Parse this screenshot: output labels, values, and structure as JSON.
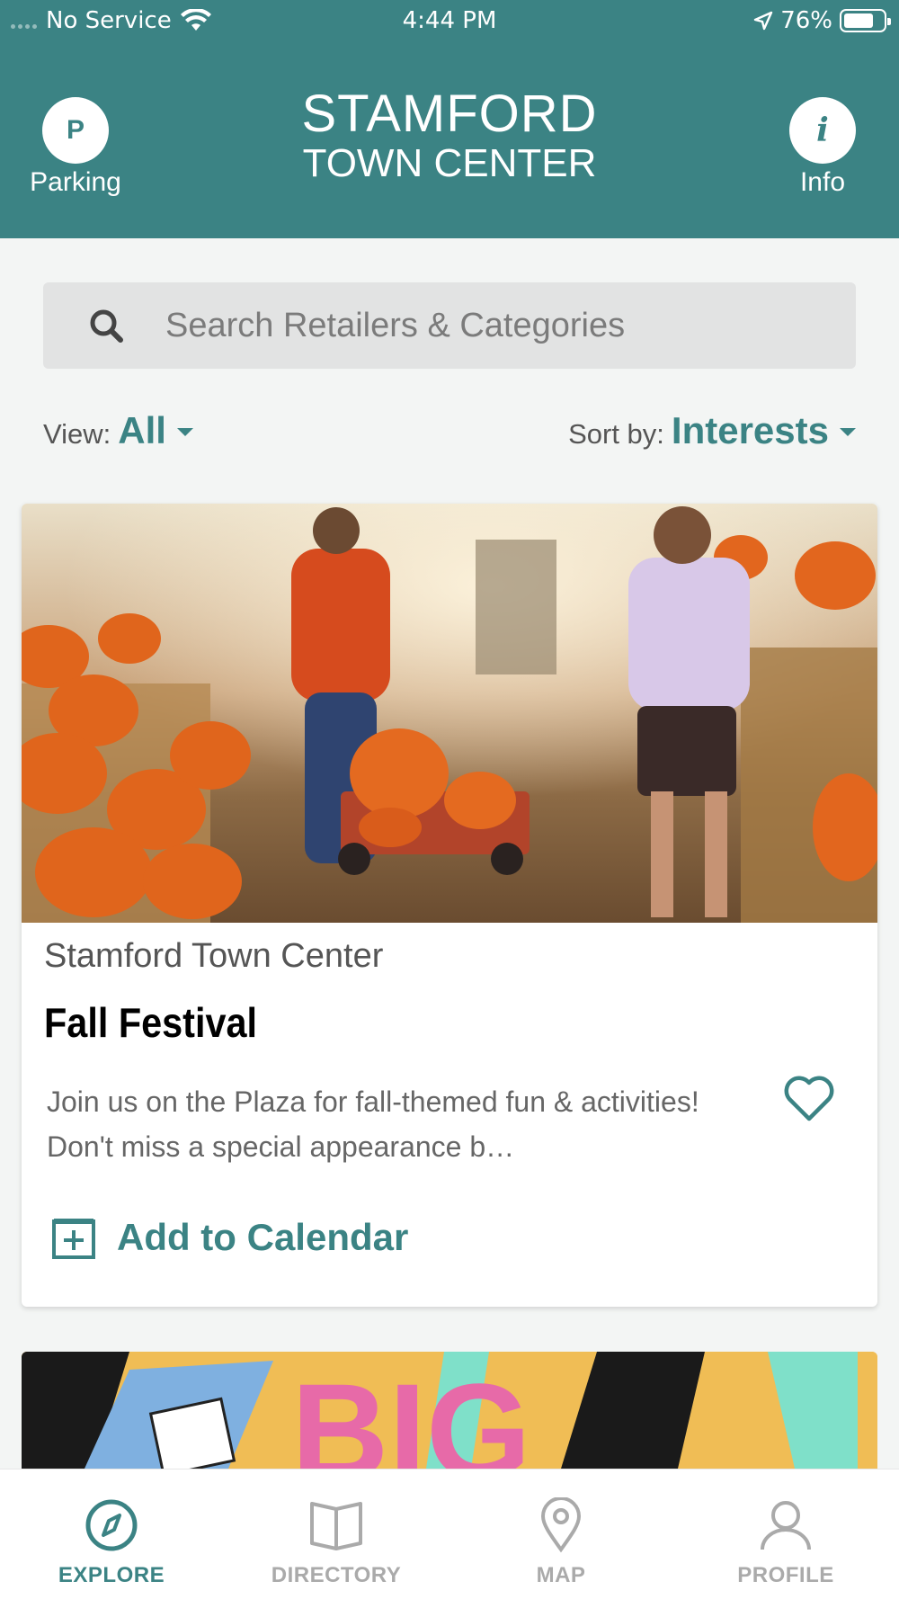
{
  "status_bar": {
    "carrier": "No Service",
    "time": "4:44 PM",
    "battery": "76%",
    "battery_level": 0.76
  },
  "header": {
    "parking_icon_letter": "P",
    "parking_label": "Parking",
    "logo_line1": "STAMFORD",
    "logo_line2": "TOWN CENTER",
    "info_icon_letter": "i",
    "info_label": "Info",
    "background_color": "#3b8384"
  },
  "search": {
    "placeholder": "Search Retailers & Categories",
    "icon": "search-icon"
  },
  "filters": {
    "view_label": "View:",
    "view_value": "All",
    "sort_label": "Sort by:",
    "sort_value": "Interests"
  },
  "card": {
    "venue": "Stamford Town Center",
    "title": "Fall Festival",
    "description": "Join us on the Plaza for fall-themed fun & activities!  Don't miss a special appearance b…",
    "add_to_calendar": "Add to Calendar",
    "favorite_icon": "heart-icon",
    "calendar_icon": "calendar-plus-icon"
  },
  "second_card": {
    "visible_text": "BIG"
  },
  "tabs": [
    {
      "label": "EXPLORE",
      "icon": "compass-icon",
      "active": true
    },
    {
      "label": "DIRECTORY",
      "icon": "book-icon",
      "active": false
    },
    {
      "label": "MAP",
      "icon": "map-pin-icon",
      "active": false
    },
    {
      "label": "PROFILE",
      "icon": "person-icon",
      "active": false
    }
  ],
  "colors": {
    "accent": "#3b8384",
    "inactive_tab": "#aaaaaa"
  }
}
